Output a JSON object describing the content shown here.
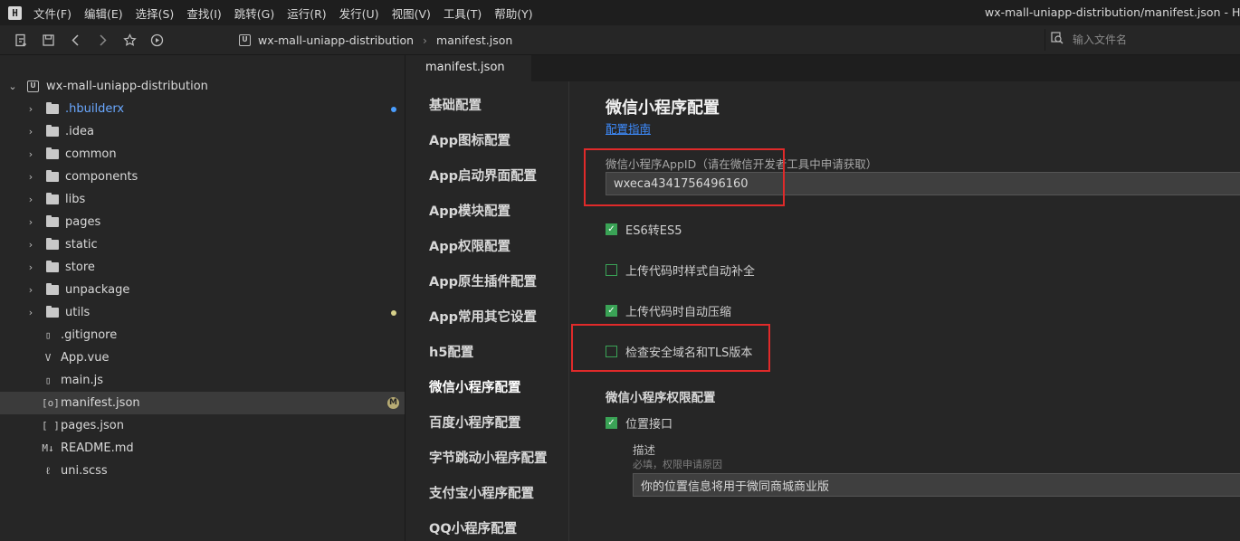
{
  "menubar": {
    "logo": "H",
    "items": [
      "文件(F)",
      "编辑(E)",
      "选择(S)",
      "查找(I)",
      "跳转(G)",
      "运行(R)",
      "发行(U)",
      "视图(V)",
      "工具(T)",
      "帮助(Y)"
    ],
    "window_title": "wx-mall-uniapp-distribution/manifest.json - HBuilderX"
  },
  "toolbar": {
    "icons": [
      "new-file-icon",
      "save-icon",
      "back-icon",
      "forward-icon",
      "star-icon",
      "run-icon"
    ],
    "breadcrumb": {
      "project_icon": "U",
      "project": "wx-mall-uniapp-distribution",
      "file": "manifest.json"
    },
    "search": {
      "placeholder": "输入文件名"
    }
  },
  "sidebar": {
    "root": {
      "icon": "U",
      "label": "wx-mall-uniapp-distribution"
    },
    "items": [
      {
        "label": ".hbuilderx",
        "type": "folder",
        "badge": "dot-blue"
      },
      {
        "label": ".idea",
        "type": "folder"
      },
      {
        "label": "common",
        "type": "folder"
      },
      {
        "label": "components",
        "type": "folder"
      },
      {
        "label": "libs",
        "type": "folder"
      },
      {
        "label": "pages",
        "type": "folder"
      },
      {
        "label": "static",
        "type": "folder"
      },
      {
        "label": "store",
        "type": "folder"
      },
      {
        "label": "unpackage",
        "type": "folder"
      },
      {
        "label": "utils",
        "type": "folder",
        "badge": "dot-yellow"
      },
      {
        "label": ".gitignore",
        "type": "file",
        "glyph": "▯"
      },
      {
        "label": "App.vue",
        "type": "file",
        "glyph": "V"
      },
      {
        "label": "main.js",
        "type": "file",
        "glyph": "▯"
      },
      {
        "label": "manifest.json",
        "type": "file",
        "glyph": "[o]",
        "selected": true,
        "badge_text": "M"
      },
      {
        "label": "pages.json",
        "type": "file",
        "glyph": "[ ]"
      },
      {
        "label": "README.md",
        "type": "file",
        "glyph": "M↓"
      },
      {
        "label": "uni.scss",
        "type": "file",
        "glyph": "ℓ"
      }
    ]
  },
  "editor": {
    "tab": "manifest.json",
    "nav": [
      "基础配置",
      "App图标配置",
      "App启动界面配置",
      "App模块配置",
      "App权限配置",
      "App原生插件配置",
      "App常用其它设置",
      "h5配置",
      "微信小程序配置",
      "百度小程序配置",
      "字节跳动小程序配置",
      "支付宝小程序配置",
      "QQ小程序配置"
    ],
    "active_nav_index": 8,
    "content": {
      "title": "微信小程序配置",
      "guide_link": "配置指南",
      "appid_label": "微信小程序AppID（请在微信开发者工具中申请获取）",
      "appid_value": "wxeca4341756496160",
      "checkboxes": [
        {
          "label": "ES6转ES5",
          "checked": true
        },
        {
          "label": "上传代码时样式自动补全",
          "checked": false
        },
        {
          "label": "上传代码时自动压缩",
          "checked": true
        },
        {
          "label": "检查安全域名和TLS版本",
          "checked": false
        }
      ],
      "permission_title": "微信小程序权限配置",
      "permission_checkbox": {
        "label": "位置接口",
        "checked": true
      },
      "desc_label": "描述",
      "desc_hint": "必填，权限申请原因",
      "desc_value": "你的位置信息将用于微同商城商业版"
    }
  },
  "colors": {
    "highlight": "#e02a2a",
    "check_green": "#3aa356",
    "link_blue": "#3d8bfd"
  }
}
